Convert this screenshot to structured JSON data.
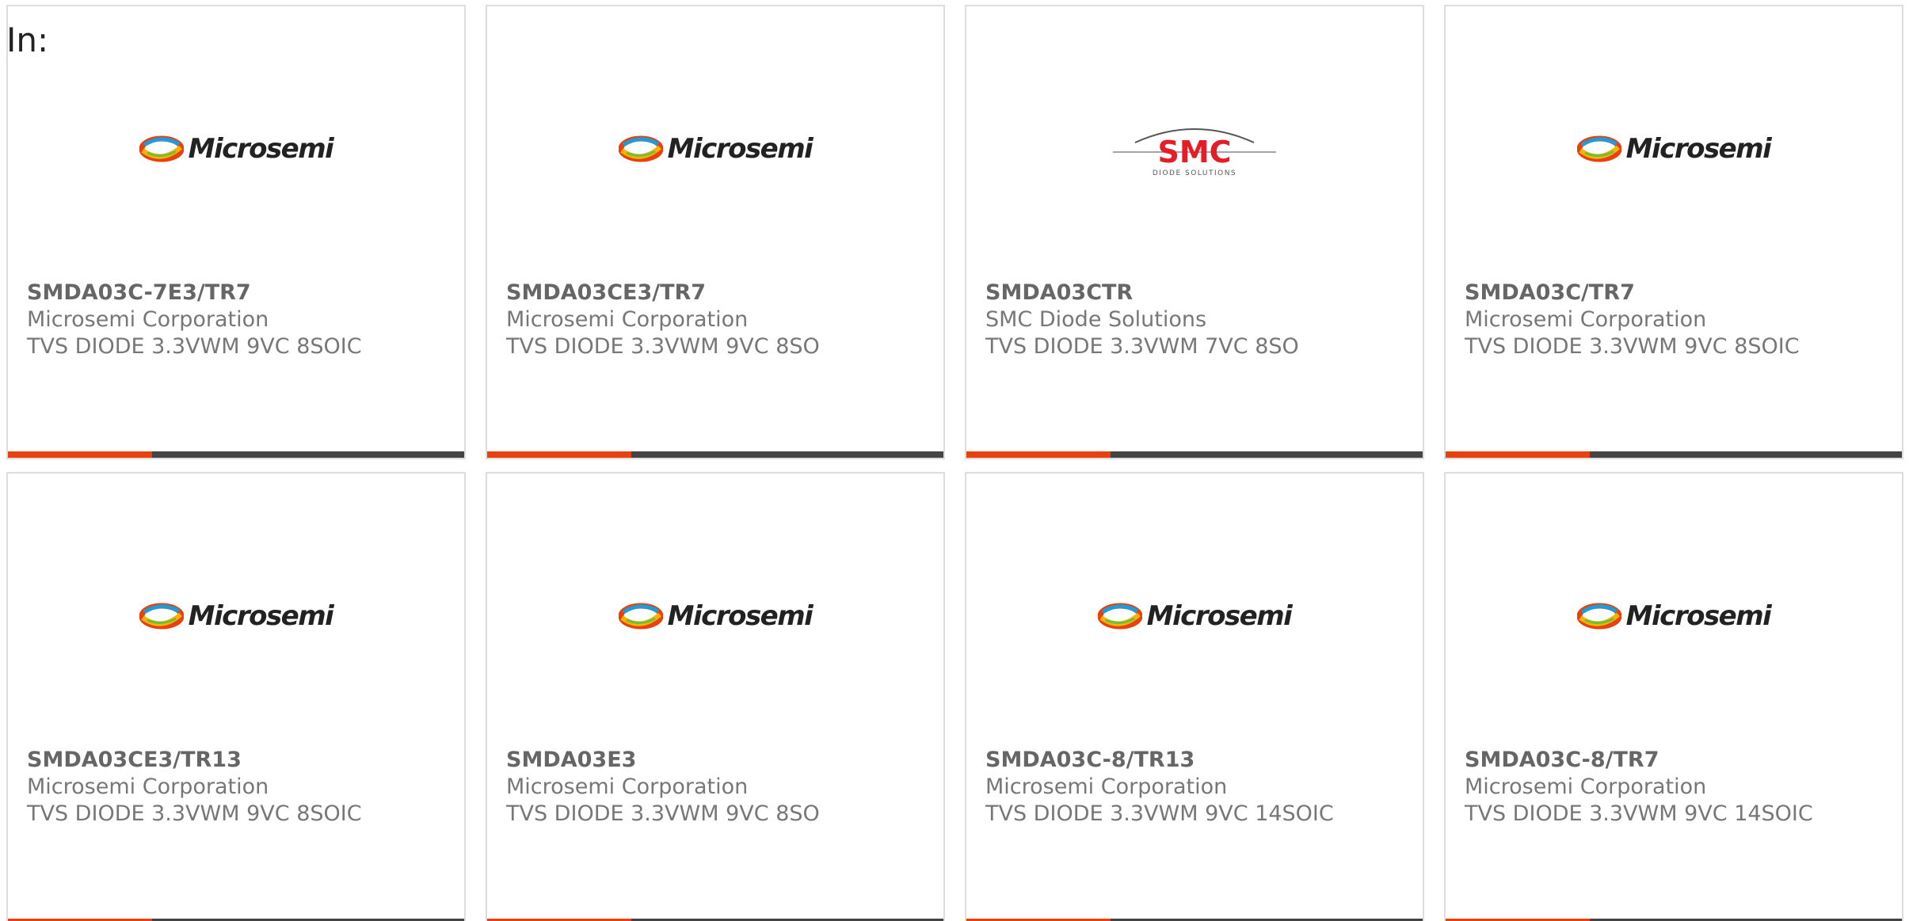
{
  "filter_label": "In:",
  "colors": {
    "accent_bar": "#e8410e",
    "dark_bar": "#444444",
    "card_border": "#dddddd",
    "smc_red": "#e41e26"
  },
  "products": [
    {
      "part": "SMDA03C-7E3/TR7",
      "manufacturer": "Microsemi Corporation",
      "description": "TVS DIODE 3.3VWM 9VC 8SOIC",
      "logo": "Microsemi"
    },
    {
      "part": "SMDA03CE3/TR7",
      "manufacturer": "Microsemi Corporation",
      "description": "TVS DIODE 3.3VWM 9VC 8SO",
      "logo": "Microsemi"
    },
    {
      "part": "SMDA03CTR",
      "manufacturer": "SMC Diode Solutions",
      "description": "TVS DIODE 3.3VWM 7VC 8SO",
      "logo": "SMC",
      "logo_sub": "DIODE SOLUTIONS"
    },
    {
      "part": "SMDA03C/TR7",
      "manufacturer": "Microsemi Corporation",
      "description": "TVS DIODE 3.3VWM 9VC 8SOIC",
      "logo": "Microsemi"
    },
    {
      "part": "SMDA03CE3/TR13",
      "manufacturer": "Microsemi Corporation",
      "description": "TVS DIODE 3.3VWM 9VC 8SOIC",
      "logo": "Microsemi"
    },
    {
      "part": "SMDA03E3",
      "manufacturer": "Microsemi Corporation",
      "description": "TVS DIODE 3.3VWM 9VC 8SO",
      "logo": "Microsemi"
    },
    {
      "part": "SMDA03C-8/TR13",
      "manufacturer": "Microsemi Corporation",
      "description": "TVS DIODE 3.3VWM 9VC 14SOIC",
      "logo": "Microsemi"
    },
    {
      "part": "SMDA03C-8/TR7",
      "manufacturer": "Microsemi Corporation",
      "description": "TVS DIODE 3.3VWM 9VC 14SOIC",
      "logo": "Microsemi"
    }
  ]
}
